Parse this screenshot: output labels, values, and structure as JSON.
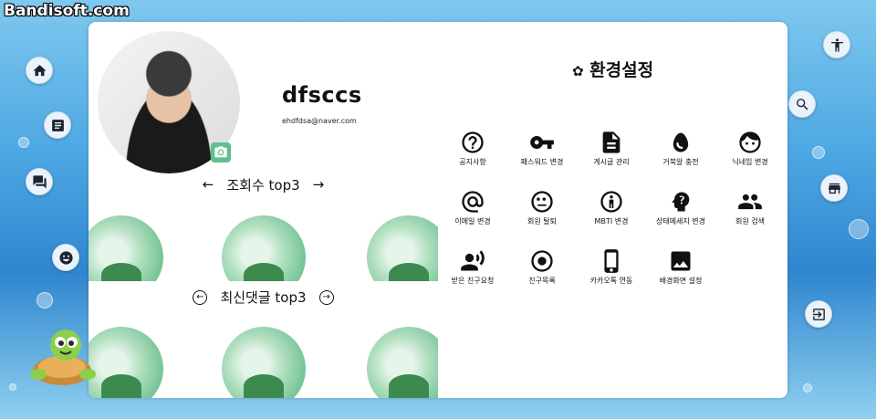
{
  "watermark": "Bandisoft.com",
  "left_nav": [
    {
      "icon": "home-icon"
    },
    {
      "icon": "article-icon"
    },
    {
      "icon": "chat-icon"
    },
    {
      "icon": "emoji-icon"
    }
  ],
  "right_nav": [
    {
      "icon": "accessibility-icon"
    },
    {
      "icon": "search-icon"
    },
    {
      "icon": "store-icon"
    },
    {
      "icon": "logout-icon"
    }
  ],
  "profile": {
    "username": "dfsccs",
    "email": "ehdfdsa@naver.com"
  },
  "views_section": {
    "title": "조회수 top3",
    "prev": "←",
    "next": "→"
  },
  "comments_section": {
    "title": "최신댓글 top3",
    "prev": "←",
    "next": "→"
  },
  "settings": {
    "title": "환경설정",
    "title_icon": "gear-icon",
    "items": [
      {
        "label": "공지사항",
        "icon": "help-circle-icon"
      },
      {
        "label": "패스워드 변경",
        "icon": "key-icon"
      },
      {
        "label": "게시글 관리",
        "icon": "document-icon"
      },
      {
        "label": "거북알 충전",
        "icon": "egg-icon"
      },
      {
        "label": "닉네임 변경",
        "icon": "face-icon"
      },
      {
        "label": "이메일 변경",
        "icon": "at-sign-icon"
      },
      {
        "label": "회원 탈퇴",
        "icon": "sad-face-icon"
      },
      {
        "label": "MBTI 변경",
        "icon": "info-person-icon"
      },
      {
        "label": "상태메세지 변경",
        "icon": "head-question-icon"
      },
      {
        "label": "회원 검색",
        "icon": "people-icon"
      },
      {
        "label": "받은 친구요청",
        "icon": "person-voice-icon"
      },
      {
        "label": "친구목록",
        "icon": "record-icon"
      },
      {
        "label": "카카오톡 연동",
        "icon": "phone-icon"
      },
      {
        "label": "배경화면 설정",
        "icon": "image-icon"
      }
    ]
  }
}
